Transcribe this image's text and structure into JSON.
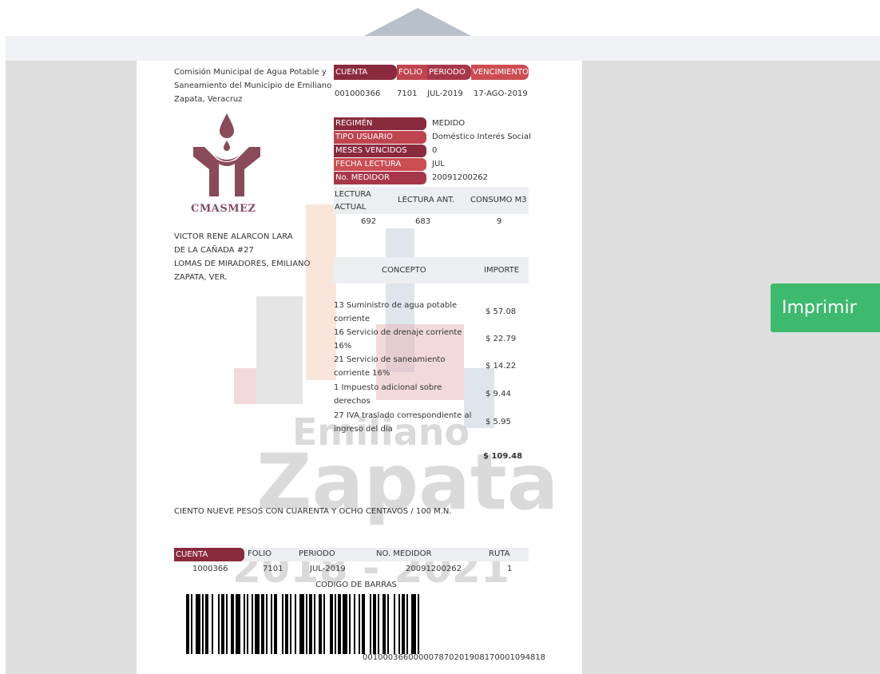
{
  "org": {
    "name": "Comisión Municipal de Agua Potable y Saneamiento del Municipio de Emiliano Zapata, Veracruz",
    "logo_text": "CMASMEZ"
  },
  "account_header": {
    "labels": [
      "CUENTA",
      "FOLIO",
      "PERIODO",
      "VENCIMIENTO"
    ],
    "values": [
      "001000366",
      "7101",
      "JUL-2019",
      "17-AGO-2019"
    ]
  },
  "details": [
    {
      "label": "REGIMÉN",
      "value": "MEDIDO"
    },
    {
      "label": "TIPO USUARIO",
      "value": "Doméstico Interés Social"
    },
    {
      "label": "MESES VENCIDOS",
      "value": "0"
    },
    {
      "label": "FECHA LECTURA",
      "value": "JUL"
    },
    {
      "label": "No. MEDIDOR",
      "value": "20091200262"
    }
  ],
  "readings": {
    "headers": [
      "LECTURA ACTUAL",
      "LECTURA ANT.",
      "CONSUMO M3"
    ],
    "values": [
      "692",
      "683",
      "9"
    ]
  },
  "customer": {
    "name": "VICTOR RENE ALARCON LARA",
    "street": "DE LA CAÑADA #27",
    "city": "LOMAS DE MIRADORES, EMILIANO ZAPATA, VER."
  },
  "charges": {
    "headers": [
      "CONCEPTO",
      "IMPORTE"
    ],
    "items": [
      {
        "concept": "13 Suministro de agua potable corriente",
        "amount": "$ 57.08"
      },
      {
        "concept": "16 Servicio de drenaje corriente 16%",
        "amount": "$ 22.79"
      },
      {
        "concept": "21 Servicio de saneamiento corriente 16%",
        "amount": "$ 14.22"
      },
      {
        "concept": "1 Impuesto adicional sobre derechos",
        "amount": "$ 9.44"
      },
      {
        "concept": "27 IVA traslado correspondiente al ingreso del dia",
        "amount": "$ 5.95"
      }
    ],
    "total": "$ 109.48"
  },
  "amount_words": "CIENTO NUEVE PESOS CON CUARENTA Y OCHO CENTAVOS / 100 M.N.",
  "stub": {
    "headers": [
      "CUENTA",
      "FOLIO",
      "PERIODO",
      "NO. MEDIDOR",
      "RUTA"
    ],
    "values": [
      "1000366",
      "7101",
      "JUL-2019",
      "20091200262",
      "1"
    ],
    "barcode_label": "CODIGO DE BARRAS",
    "barcode_number": "0010003660000078702019081700010948​18"
  },
  "watermark": {
    "line1": "Emiliano",
    "line2": "Zapata",
    "line3": "2018 - 2021"
  },
  "actions": {
    "print_label": "Imprimir"
  },
  "colors": {
    "accent_dark": "#8a2a3d",
    "accent": "#c0444f",
    "button": "#3dba6e"
  }
}
